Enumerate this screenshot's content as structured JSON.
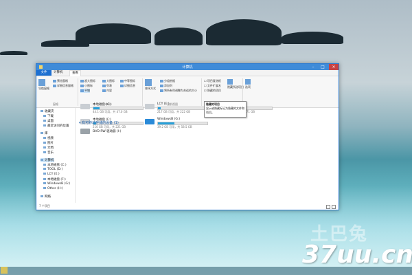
{
  "window": {
    "title": "计算机"
  },
  "tabs": [
    "文件",
    "计算机",
    "查看"
  ],
  "ribbon": {
    "buttons": {
      "nav_pane": "导航窗格",
      "preview_pane": "预览窗格",
      "details_pane": "详细信息窗格",
      "xlarge_icons": "超大图标",
      "small_icons": "小图标",
      "tiles": "平铺",
      "large_icons": "大图标",
      "list": "列表",
      "content": "内容",
      "medium_icons": "中等图标",
      "details": "详细信息",
      "sort_by": "排序方式",
      "group_by": "分组依据",
      "add_columns": "添加列",
      "size_columns": "将所有列调整为合适的大小",
      "item_checkboxes": "项目复选框",
      "file_extensions": "文件扩展名",
      "hidden_items": "隐藏的项目",
      "hide_selected": "隐藏所选项目",
      "options": "选项"
    },
    "groups": {
      "panes": "窗格",
      "layout": "布局",
      "current_view": "当前视图",
      "show_hide": "显示/隐藏"
    }
  },
  "tooltip": {
    "title": "隐藏的项目",
    "text": "显示或隐藏标记为隐藏的文件和项目。"
  },
  "nav": {
    "items": [
      "收藏夹",
      "下载",
      "桌面",
      "最近访问的位置",
      "库",
      "视频",
      "图片",
      "文档",
      "音乐",
      "计算机",
      "本地磁盘 (C:)",
      "TOOL (D:)",
      "LCY (E:)",
      "本地磁盘 (F:)",
      "WindowsB (G:)",
      "Other (H:)",
      "网络"
    ]
  },
  "drives": [
    {
      "name": "本地磁盘 (C:)",
      "size": "44.1 GB 可用，共 47.0 GB",
      "fill": 0.12
    },
    {
      "name": "LCY (E:)",
      "size": "217 GB 可用，共 222 GB",
      "fill": 0.05
    },
    {
      "name": "本地磁盘 (F:)",
      "size": "210 GB 可用，共 221 GB",
      "fill": 0.06
    },
    {
      "name": "WindowsB (G:)",
      "size": "39.2 GB 可用，共 58.5 GB",
      "fill": 0.34
    },
    {
      "name": "Other (H:)",
      "size": "161 GB 可用，共 171 GB",
      "fill": 0.06
    }
  ],
  "removable_section": "有可移动存储的设备 (1)",
  "dvd": {
    "name": "DVD RW 驱动器 (I:)"
  },
  "status": "7 个项目",
  "watermark": {
    "logo": "土巴兔",
    "text": "37uu.cn"
  },
  "colors": {
    "accent": "#1c6fd1",
    "titlebar": "#3f8bd8"
  }
}
